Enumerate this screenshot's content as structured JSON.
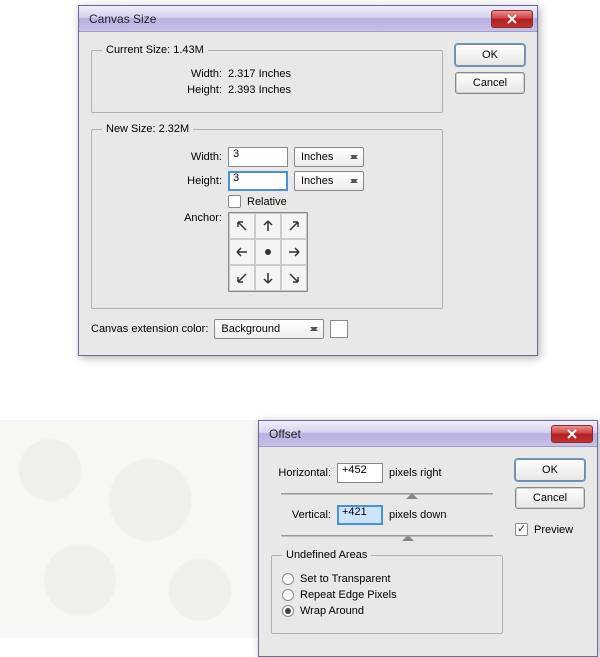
{
  "canvas": {
    "title": "Canvas Size",
    "ok": "OK",
    "cancel": "Cancel",
    "currentSize": {
      "legend": "Current Size: 1.43M",
      "widthLabel": "Width:",
      "widthValue": "2.317 Inches",
      "heightLabel": "Height:",
      "heightValue": "2.393 Inches"
    },
    "newSize": {
      "legend": "New Size: 2.32M",
      "widthLabel": "Width:",
      "widthValue": "3",
      "widthUnit": "Inches",
      "heightLabel": "Height:",
      "heightValue": "3",
      "heightUnit": "Inches",
      "relativeLabel": "Relative",
      "anchorLabel": "Anchor:"
    },
    "extensionLabel": "Canvas extension color:",
    "extensionValue": "Background"
  },
  "offset": {
    "title": "Offset",
    "ok": "OK",
    "cancel": "Cancel",
    "previewLabel": "Preview",
    "horizLabel": "Horizontal:",
    "horizValue": "+452",
    "horizUnit": "pixels right",
    "vertLabel": "Vertical:",
    "vertValue": "+421",
    "vertUnit": "pixels down",
    "undefined": {
      "legend": "Undefined Areas",
      "opt1": "Set to Transparent",
      "opt2": "Repeat Edge Pixels",
      "opt3": "Wrap Around"
    }
  }
}
